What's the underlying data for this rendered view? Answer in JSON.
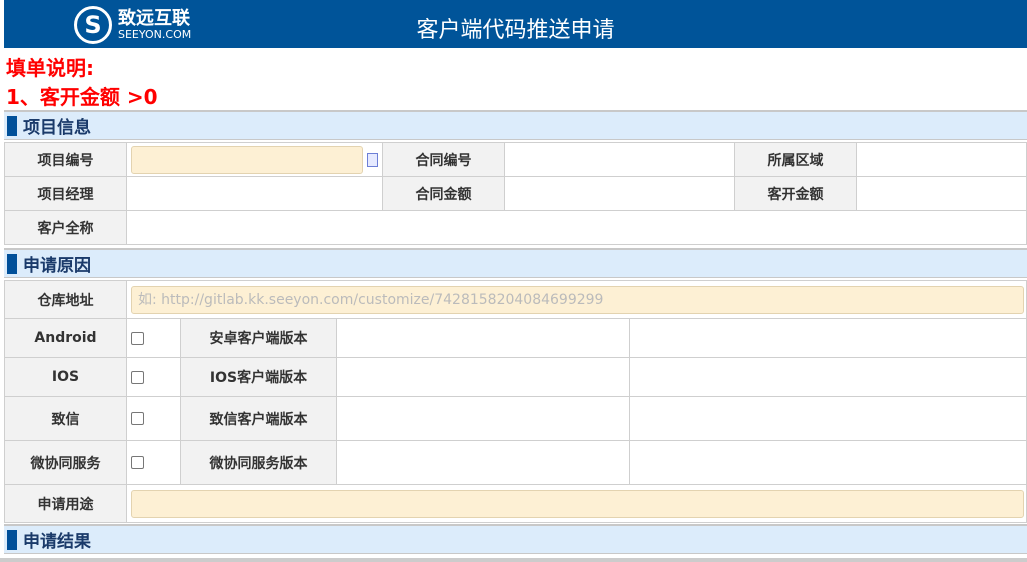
{
  "header": {
    "logo_cn": "致远互联",
    "logo_en": "SEEYON.COM",
    "title": "客户端代码推送申请"
  },
  "notes": {
    "heading": "填单说明:",
    "line1": "1、客开金额 >0"
  },
  "sections": {
    "project": "项目信息",
    "reason": "申请原因",
    "result": "申请结果"
  },
  "project": {
    "project_no": "项目编号",
    "contract_no": "合同编号",
    "region": "所属区域",
    "manager": "项目经理",
    "contract_amount": "合同金额",
    "custom_amount": "客开金额",
    "customer_name": "客户全称"
  },
  "reason": {
    "repo_label": "仓库地址",
    "repo_placeholder": "如: http://gitlab.kk.seeyon.com/customize/7428158204084699299",
    "rows": [
      {
        "label": "Android",
        "version_label": "安卓客户端版本",
        "checked": false
      },
      {
        "label": "IOS",
        "version_label": "IOS客户端版本",
        "checked": false
      },
      {
        "label": "致信",
        "version_label": "致信客户端版本",
        "checked": false
      },
      {
        "label": "微协同服务",
        "version_label": "微协同服务版本",
        "checked": false
      }
    ],
    "purpose_label": "申请用途"
  }
}
